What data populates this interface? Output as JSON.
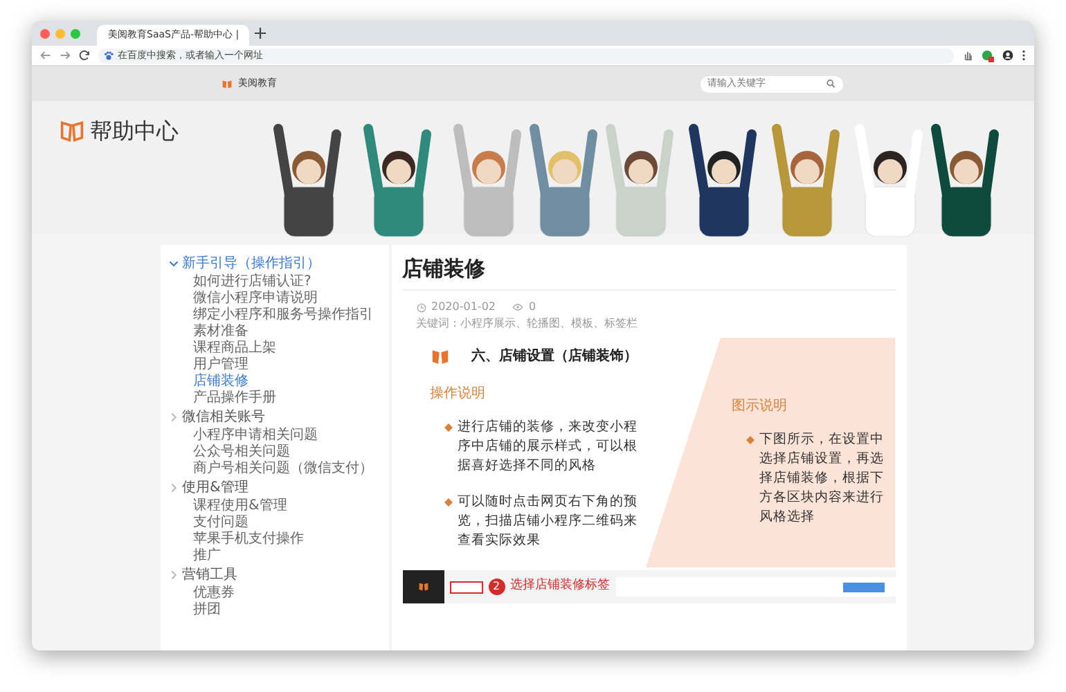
{
  "browser": {
    "tab_title": "美阅教育SaaS产品-帮助中心 |",
    "address_placeholder": "在百度中搜索，或者输入一个网址"
  },
  "header": {
    "logo_text": "美阅教育",
    "search_placeholder": "请输入关键字"
  },
  "hero": {
    "title": "帮助中心"
  },
  "sidebar": {
    "groups": [
      {
        "label": "新手引导（操作指引）",
        "expanded": true,
        "items": [
          {
            "label": "如何进行店铺认证?",
            "selected": false
          },
          {
            "label": "微信小程序申请说明",
            "selected": false
          },
          {
            "label": "绑定小程序和服务号操作指引",
            "selected": false
          },
          {
            "label": "素材准备",
            "selected": false
          },
          {
            "label": "课程商品上架",
            "selected": false
          },
          {
            "label": "用户管理",
            "selected": false
          },
          {
            "label": "店铺装修",
            "selected": true
          },
          {
            "label": "产品操作手册",
            "selected": false
          }
        ]
      },
      {
        "label": "微信相关账号",
        "expanded": false,
        "items": [
          {
            "label": "小程序申请相关问题",
            "selected": false
          },
          {
            "label": "公众号相关问题",
            "selected": false
          },
          {
            "label": "商户号相关问题（微信支付）",
            "selected": false
          }
        ]
      },
      {
        "label": "使用&管理",
        "expanded": false,
        "items": [
          {
            "label": "课程使用&管理",
            "selected": false
          },
          {
            "label": "支付问题",
            "selected": false
          },
          {
            "label": "苹果手机支付操作",
            "selected": false
          },
          {
            "label": "推广",
            "selected": false
          }
        ]
      },
      {
        "label": "营销工具",
        "expanded": false,
        "items": [
          {
            "label": "优惠券",
            "selected": false
          },
          {
            "label": "拼团",
            "selected": false
          }
        ]
      }
    ]
  },
  "article": {
    "title": "店铺装修",
    "date": "2020-01-02",
    "views": "0",
    "keywords": "关键词：小程序展示、轮播图、模板、标签栏",
    "section_title": "六、店铺设置（店铺装饰）",
    "left_heading": "操作说明",
    "left_points": [
      "进行店铺的装修，来改变小程序中店铺的展示样式，可以根据喜好选择不同的风格",
      "可以随时点击网页右下角的预览，扫描店铺小程序二维码来查看实际效果"
    ],
    "right_heading": "图示说明",
    "right_points": [
      "下图所示，在设置中选择店铺设置，再选择店铺装修，根据下方各区块内容来进行风格选择"
    ],
    "screenshot": {
      "step": "2",
      "callout": "选择店铺装修标签"
    }
  }
}
